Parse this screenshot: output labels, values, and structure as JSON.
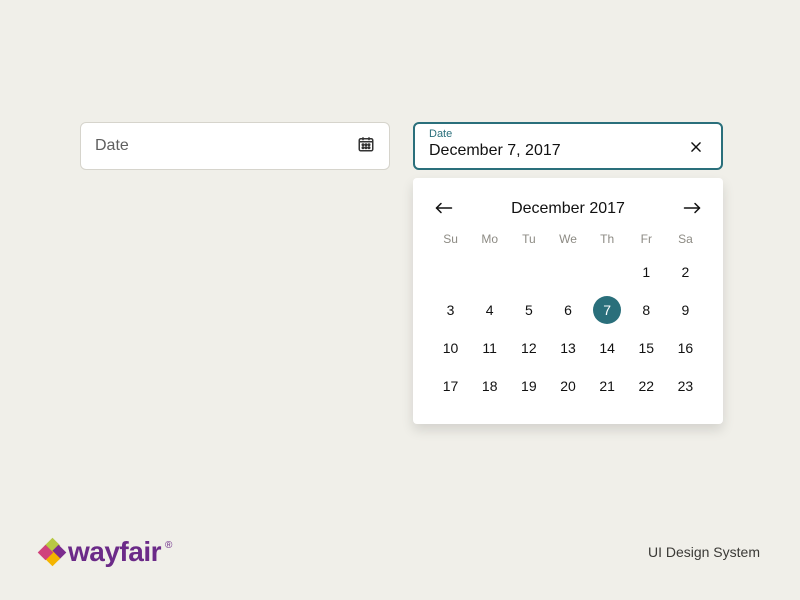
{
  "closed_field": {
    "placeholder": "Date"
  },
  "open_field": {
    "label": "Date",
    "value": "December 7, 2017"
  },
  "calendar": {
    "month_title": "December 2017",
    "dow": [
      "Su",
      "Mo",
      "Tu",
      "We",
      "Th",
      "Fr",
      "Sa"
    ],
    "leading_blanks": 5,
    "days_shown": 23,
    "selected_day": 7
  },
  "brand": {
    "name": "wayfair",
    "reg": "®"
  },
  "tagline": "UI Design System"
}
